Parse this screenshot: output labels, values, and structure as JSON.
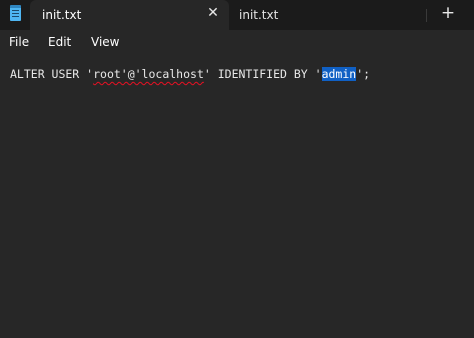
{
  "tabs": [
    {
      "label": "init.txt",
      "active": true
    },
    {
      "label": "init.txt",
      "active": false
    }
  ],
  "icons": {
    "app": "notepad-icon",
    "close": "close-icon",
    "new_tab": "plus-icon"
  },
  "glyphs": {
    "close": "✕",
    "new_tab": "+"
  },
  "menu": {
    "items": [
      "File",
      "Edit",
      "View"
    ]
  },
  "editor": {
    "text_before": "ALTER USER '",
    "misspelled": "root'@'localhost",
    "text_middle": "' IDENTIFIED BY '",
    "selected": "admin",
    "text_after": "';"
  },
  "colors": {
    "background": "#272727",
    "tabbar": "#1b1b1b",
    "selection": "#1060c4",
    "spellcheck": "#e81123"
  }
}
